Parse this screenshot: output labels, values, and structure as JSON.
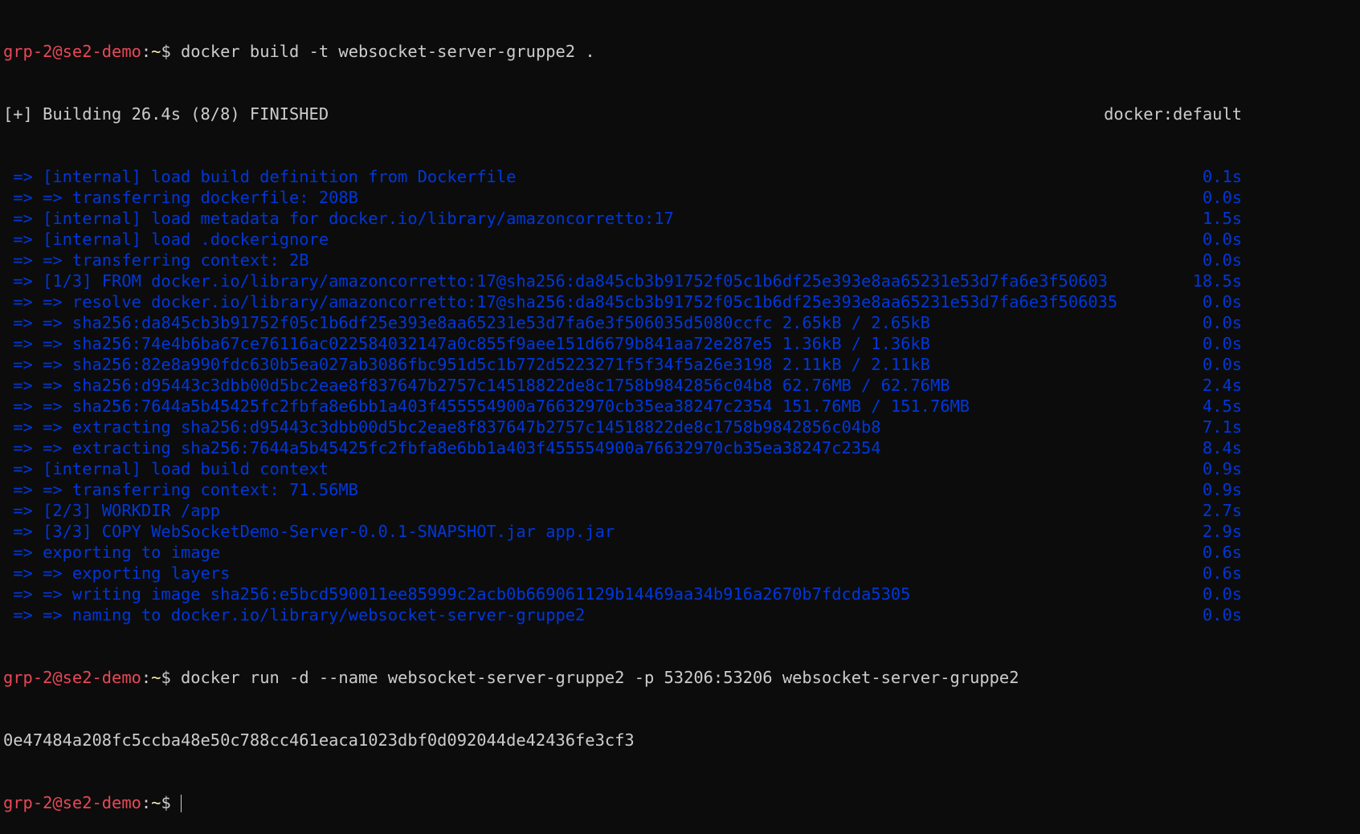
{
  "prompt": {
    "user_host": "grp-2@se2-demo",
    "sep": ":",
    "path": "~",
    "symbol": "$ "
  },
  "commands": {
    "build": "docker build -t websocket-server-gruppe2 .",
    "run": "docker run -d --name websocket-server-gruppe2 -p 53206:53206 websocket-server-gruppe2"
  },
  "build_header": {
    "text": "[+] Building 26.4s (8/8) FINISHED",
    "context": "docker:default"
  },
  "build_steps": [
    {
      "text": " => [internal] load build definition from Dockerfile",
      "time": "0.1s"
    },
    {
      "text": " => => transferring dockerfile: 208B",
      "time": "0.0s"
    },
    {
      "text": " => [internal] load metadata for docker.io/library/amazoncorretto:17",
      "time": "1.5s"
    },
    {
      "text": " => [internal] load .dockerignore",
      "time": "0.0s"
    },
    {
      "text": " => => transferring context: 2B",
      "time": "0.0s"
    },
    {
      "text": " => [1/3] FROM docker.io/library/amazoncorretto:17@sha256:da845cb3b91752f05c1b6df25e393e8aa65231e53d7fa6e3f50603",
      "time": "18.5s"
    },
    {
      "text": " => => resolve docker.io/library/amazoncorretto:17@sha256:da845cb3b91752f05c1b6df25e393e8aa65231e53d7fa6e3f506035",
      "time": "0.0s"
    },
    {
      "text": " => => sha256:da845cb3b91752f05c1b6df25e393e8aa65231e53d7fa6e3f506035d5080ccfc 2.65kB / 2.65kB",
      "time": "0.0s"
    },
    {
      "text": " => => sha256:74e4b6ba67ce76116ac022584032147a0c855f9aee151d6679b841aa72e287e5 1.36kB / 1.36kB",
      "time": "0.0s"
    },
    {
      "text": " => => sha256:82e8a990fdc630b5ea027ab3086fbc951d5c1b772d5223271f5f34f5a26e3198 2.11kB / 2.11kB",
      "time": "0.0s"
    },
    {
      "text": " => => sha256:d95443c3dbb00d5bc2eae8f837647b2757c14518822de8c1758b9842856c04b8 62.76MB / 62.76MB",
      "time": "2.4s"
    },
    {
      "text": " => => sha256:7644a5b45425fc2fbfa8e6bb1a403f455554900a76632970cb35ea38247c2354 151.76MB / 151.76MB",
      "time": "4.5s"
    },
    {
      "text": " => => extracting sha256:d95443c3dbb00d5bc2eae8f837647b2757c14518822de8c1758b9842856c04b8",
      "time": "7.1s"
    },
    {
      "text": " => => extracting sha256:7644a5b45425fc2fbfa8e6bb1a403f455554900a76632970cb35ea38247c2354",
      "time": "8.4s"
    },
    {
      "text": " => [internal] load build context",
      "time": "0.9s"
    },
    {
      "text": " => => transferring context: 71.56MB",
      "time": "0.9s"
    },
    {
      "text": " => [2/3] WORKDIR /app",
      "time": "2.7s"
    },
    {
      "text": " => [3/3] COPY WebSocketDemo-Server-0.0.1-SNAPSHOT.jar app.jar",
      "time": "2.9s"
    },
    {
      "text": " => exporting to image",
      "time": "0.6s"
    },
    {
      "text": " => => exporting layers",
      "time": "0.6s"
    },
    {
      "text": " => => writing image sha256:e5bcd590011ee85999c2acb0b669061129b14469aa34b916a2670b7fdcda5305",
      "time": "0.0s"
    },
    {
      "text": " => => naming to docker.io/library/websocket-server-gruppe2",
      "time": "0.0s"
    }
  ],
  "run_output": "0e47484a208fc5ccba48e50c788cc461eaca1023dbf0d092044de42436fe3cf3",
  "colors": {
    "background": "#0c0c0c",
    "text": "#cccccc",
    "step": "#0037da",
    "prompt": "#e74856",
    "path": "#f9f1a5"
  }
}
